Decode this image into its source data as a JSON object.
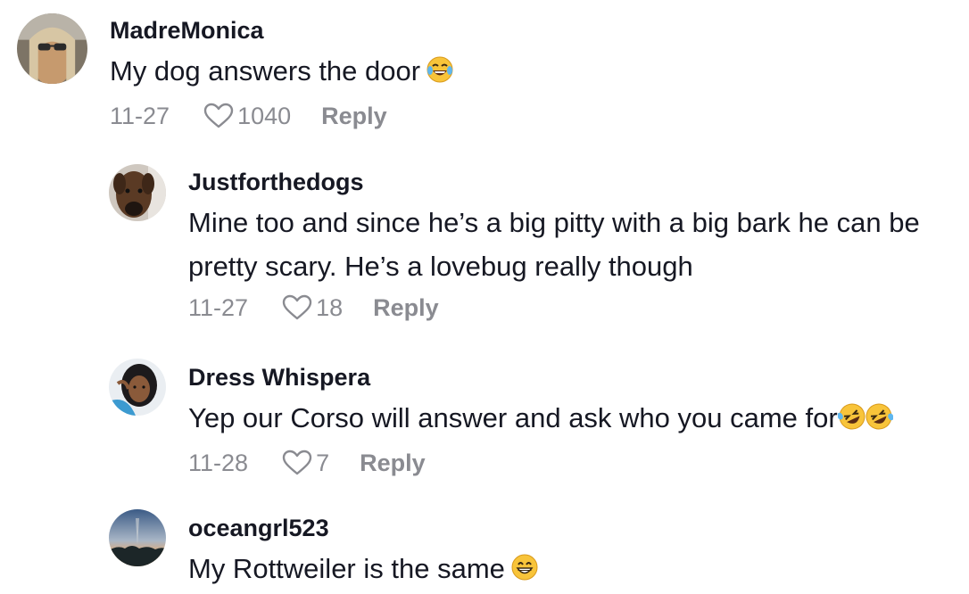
{
  "comments": [
    {
      "username": "MadreMonica",
      "text": "My dog answers the door",
      "emoji": "😂",
      "date": "11-27",
      "likes": "1040",
      "reply_label": "Reply"
    },
    {
      "username": "Justforthedogs",
      "text": "Mine too and since he’s a big pitty with a big bark he can be pretty scary. He’s a lovebug really though",
      "date": "11-27",
      "likes": "18",
      "reply_label": "Reply"
    },
    {
      "username": "Dress Whispera",
      "text": "Yep our Corso will answer and ask who you came for",
      "emoji": "🤣🤣",
      "date": "11-28",
      "likes": "7",
      "reply_label": "Reply"
    },
    {
      "username": "oceangrl523",
      "text": "My Rottweiler is the same",
      "emoji": "😁"
    }
  ],
  "icons": {
    "like": "heart-outline-icon"
  },
  "colors": {
    "username": "#161823",
    "text": "#161823",
    "meta": "#8a8b91",
    "emoji_face": "#f8c43a"
  }
}
